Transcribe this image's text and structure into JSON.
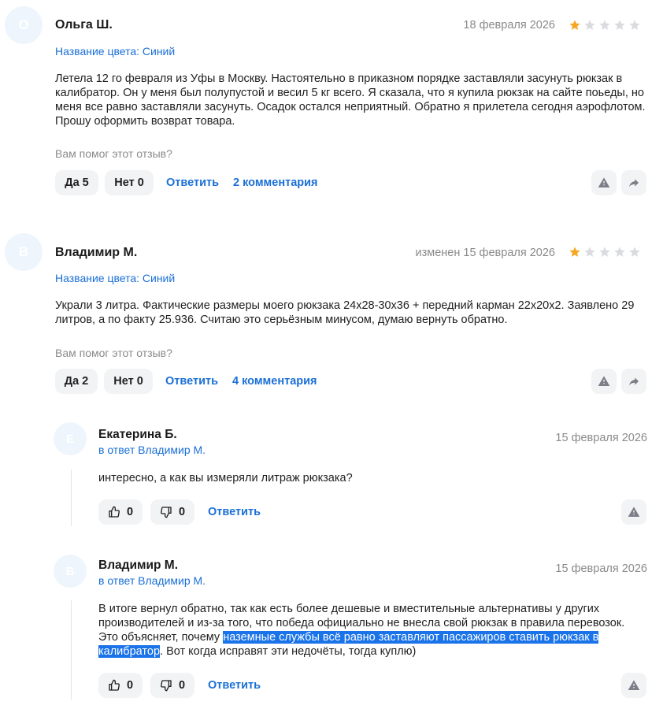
{
  "reviews": [
    {
      "avatar_letter": "О",
      "author": "Ольга Ш.",
      "date": "18 февраля 2026",
      "rating": 1,
      "color_attr": "Название цвета: Синий",
      "text_lines": [
        "Летела 12 го февраля из Уфы в Москву. Настоятельно в приказном порядке заставляли засунуть рюкзак в",
        "калибратор. Он у меня был полупустой и весил 5 кг всего. Я сказала, что я купила рюкзак на сайте поьеды, но",
        "меня все равно заставляли засунуть. Осадок остался неприятный. Обратно я прилетела сегодня аэрофлотом.",
        "Прошу оформить возврат товара."
      ],
      "helpful_question": "Вам помог этот отзыв?",
      "yes_label": "Да 5",
      "no_label": "Нет 0",
      "reply_label": "Ответить",
      "comments_label": "2 комментария"
    },
    {
      "avatar_letter": "В",
      "author": "Владимир М.",
      "date": "изменен 15 февраля 2026",
      "rating": 1,
      "color_attr": "Название цвета: Синий",
      "text_lines": [
        "Украли 3 литра. Фактические размеры моего рюкзака 24х28-30х36 + передний карман 22х20х2. Заявлено 29",
        "литров, а по факту 25.936. Считаю это серьёзным минусом, думаю вернуть обратно."
      ],
      "helpful_question": "Вам помог этот отзыв?",
      "yes_label": "Да 2",
      "no_label": "Нет 0",
      "reply_label": "Ответить",
      "comments_label": "4 комментария"
    }
  ],
  "comments": [
    {
      "avatar_letter": "Е",
      "author": "Екатерина Б.",
      "reply_to": "в ответ Владимир М.",
      "date": "15 февраля 2026",
      "text_lines": [
        "интересно, а как вы измеряли литраж рюкзака?"
      ],
      "likes": "0",
      "dislikes": "0",
      "reply_label": "Ответить"
    },
    {
      "avatar_letter": "В",
      "author": "Владимир М.",
      "reply_to": "в ответ Владимир М.",
      "date": "15 февраля 2026",
      "line1": "В итоге вернул обратно, так как есть более дешевые и вместительные альтернативы у других",
      "line2": "производителей и из-за того, что победа официально не внесла свой рюкзак в правила перевозок.",
      "line3_plain": "Это объясняет, почему ",
      "line3_highlight": "наземные службы всё равно заставляют пассажиров ставить рюкзак в",
      "line4_highlight": "калибратор",
      "line4_plain": ". Вот когда исправят эти недочёты, тогда куплю)",
      "likes": "0",
      "dislikes": "0",
      "reply_label": "Ответить"
    }
  ],
  "colors": {
    "accent": "#1a6fd6",
    "star_filled": "#f5a623",
    "star_empty": "#d9dbdf",
    "button_bg": "#f2f3f5",
    "highlight": "#1a73e8"
  }
}
